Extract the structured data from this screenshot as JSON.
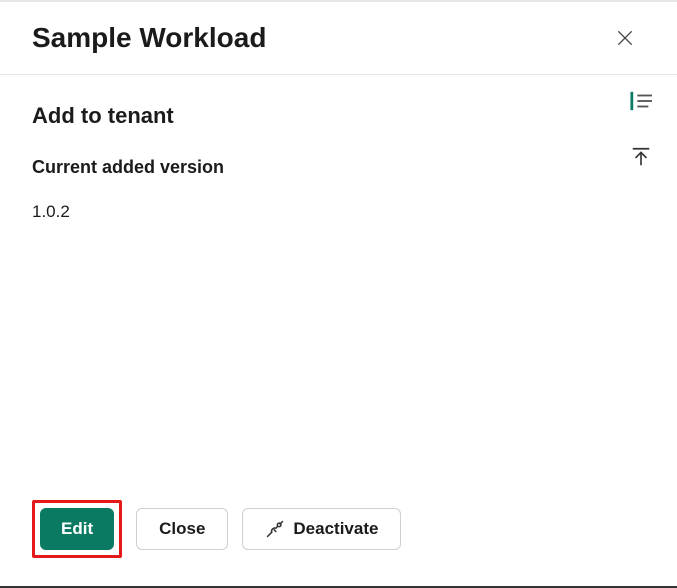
{
  "colors": {
    "accent": "#0b7a62",
    "highlight": "#e31919"
  },
  "header": {
    "title": "Sample Workload"
  },
  "section": {
    "title": "Add to tenant",
    "version_label": "Current added version",
    "version_value": "1.0.2"
  },
  "buttons": {
    "edit": "Edit",
    "close": "Close",
    "deactivate": "Deactivate"
  },
  "side_icons": {
    "first": "list-icon",
    "second": "scroll-top-icon"
  }
}
